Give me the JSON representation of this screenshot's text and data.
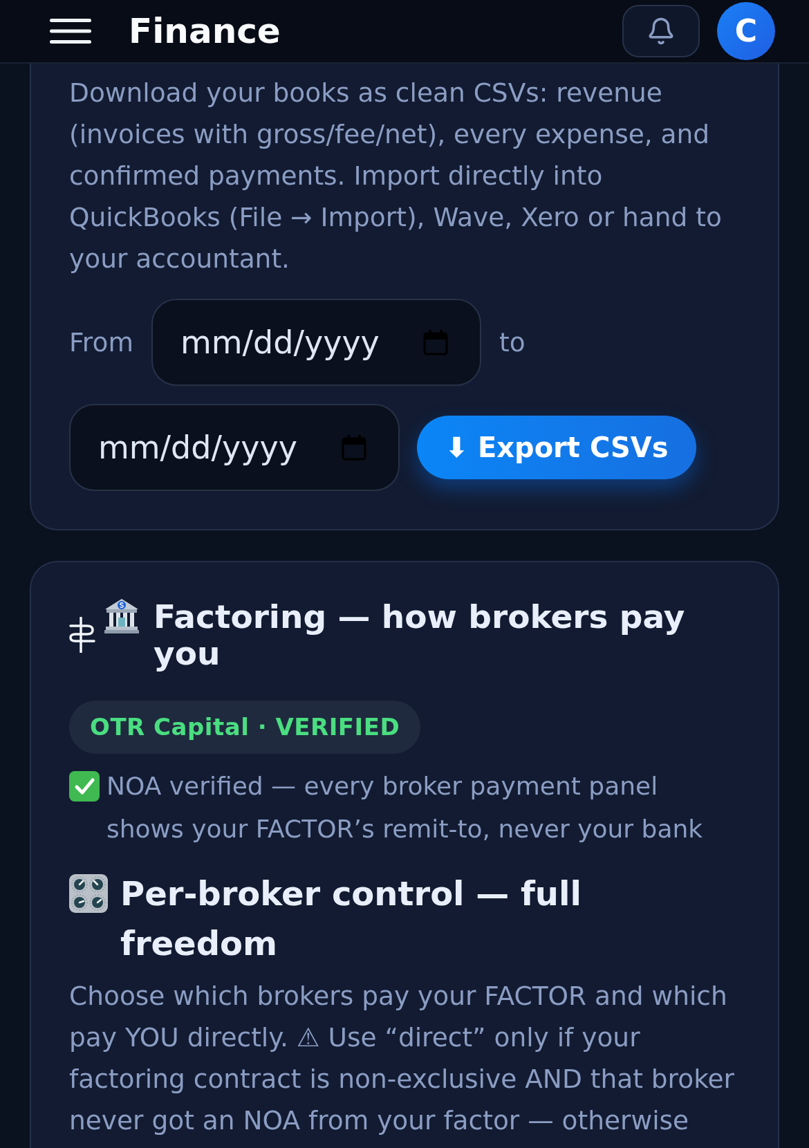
{
  "header": {
    "title": "Finance",
    "avatar_initial": "C"
  },
  "export_card": {
    "description": "Download your books as clean CSVs: revenue (invoices with gross/fee/net), every expense, and confirmed payments. Import directly into QuickBooks (File → Import), Wave, Xero or hand to your accountant.",
    "from_label": "From",
    "from_field": {
      "placeholder": "mm/dd/yyyy"
    },
    "to_label": "to",
    "to_field": {
      "placeholder": "mm/dd/yyyy"
    },
    "export_button": "⬇ Export CSVs"
  },
  "factoring_card": {
    "title": "Factoring — how brokers pay you",
    "factor_badge": "OTR Capital · VERIFIED",
    "noa_status": "NOA verified — every broker payment panel shows your FACTOR’s remit-to, never your bank",
    "control_title": "Per-broker control — full freedom",
    "control_description": "Choose which brokers pay your FACTOR and which pay YOU directly. ⚠ Use “direct” only if your factoring contract is non-exclusive AND that broker never got an NOA from your factor — otherwise"
  }
}
